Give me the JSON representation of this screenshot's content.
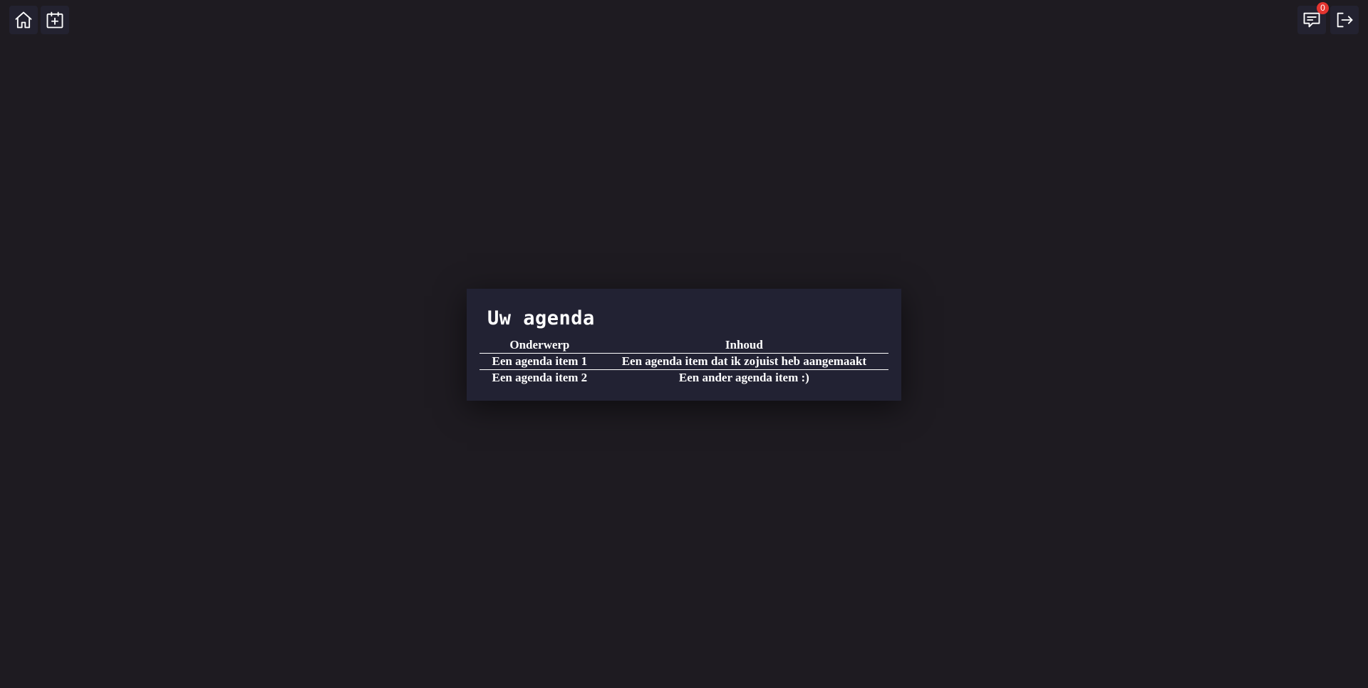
{
  "nav": {
    "left_icons": [
      "home-icon",
      "calendar-add-icon"
    ],
    "right_icons": [
      "message-icon",
      "logout-icon"
    ],
    "message_count": "0"
  },
  "colors": {
    "background": "#1e1b21",
    "card": "#222233",
    "badge": "#e3342f"
  },
  "agenda": {
    "title": "Uw agenda",
    "columns": [
      "Onderwerp",
      "Inhoud"
    ],
    "rows": [
      [
        "Een agenda item 1",
        "Een agenda item dat ik zojuist heb aangemaakt"
      ],
      [
        "Een agenda item 2",
        "Een ander agenda item :)"
      ]
    ]
  }
}
